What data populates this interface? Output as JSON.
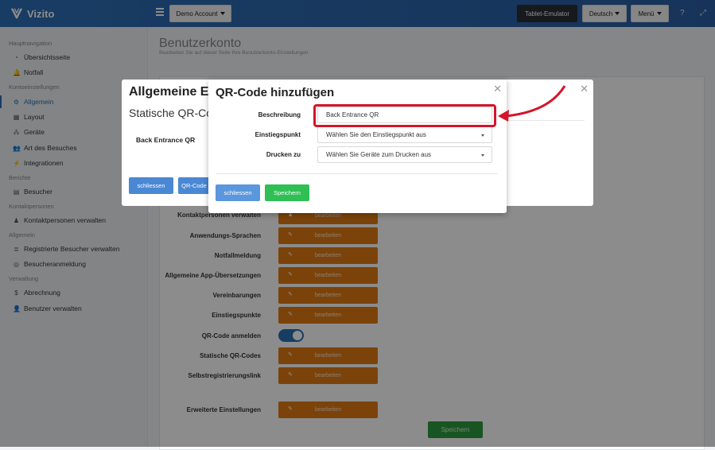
{
  "brand": "Vizito",
  "topbar": {
    "account": "Demo Account",
    "tablet": "Tablet-Emulator",
    "language": "Deutsch",
    "menu": "Menü"
  },
  "sidebar": {
    "sections": [
      {
        "title": "Hauptnavigation",
        "items": [
          {
            "label": "Übersichtsseite",
            "icon": "dashboard-icon"
          },
          {
            "label": "Notfall",
            "icon": "bell-icon"
          }
        ]
      },
      {
        "title": "Kontoeinstellungen",
        "items": [
          {
            "label": "Allgemein",
            "icon": "gear-icon"
          },
          {
            "label": "Layout",
            "icon": "layout-icon"
          },
          {
            "label": "Geräte",
            "icon": "devices-icon"
          },
          {
            "label": "Art des Besuches",
            "icon": "users-icon"
          },
          {
            "label": "Integrationen",
            "icon": "plug-icon"
          }
        ]
      },
      {
        "title": "Berichte",
        "items": [
          {
            "label": "Besucher",
            "icon": "report-icon"
          }
        ]
      },
      {
        "title": "Kontaktpersonen",
        "items": [
          {
            "label": "Kontaktpersonen verwalten",
            "icon": "person-icon"
          }
        ]
      },
      {
        "title": "Allgemein",
        "items": [
          {
            "label": "Registrierte Besucher verwalten",
            "icon": "list-icon"
          },
          {
            "label": "Besucheranmeldung",
            "icon": "target-icon"
          }
        ]
      },
      {
        "title": "Verwaltung",
        "items": [
          {
            "label": "Abrechnung",
            "icon": "dollar-icon"
          },
          {
            "label": "Benutzer verwalten",
            "icon": "user-plus-icon"
          }
        ]
      }
    ]
  },
  "page": {
    "title": "Benutzerkonto",
    "subtitle": "Bearbeiten Sie auf dieser Seite Ihre Benutzerkonto-Einstellungen"
  },
  "settings_rows": [
    {
      "label": "Kontaktpersonen verwalten",
      "button": "bearbeiten"
    },
    {
      "label": "Anwendungs-Sprachen",
      "button": "bearbeiten"
    },
    {
      "label": "Notfallmeldung",
      "button": "bearbeiten"
    },
    {
      "label": "Allgemeine App-Übersetzungen",
      "button": "bearbeiten"
    },
    {
      "label": "Vereinbarungen",
      "button": "bearbeiten"
    },
    {
      "label": "Einstiegspunkte",
      "button": "bearbeiten"
    },
    {
      "label": "QR-Code anmelden",
      "toggle": true
    },
    {
      "label": "Statische QR-Codes",
      "button": "bearbeiten"
    },
    {
      "label": "Selbstregistrierungslink",
      "button": "bearbeiten"
    },
    {
      "label": "Erweiterte Einstellungen",
      "button": "bearbeiten"
    }
  ],
  "main_save": "Speichern",
  "back_modal": {
    "title": "Allgemeine Eins",
    "subtitle": "Statische QR-Code",
    "qr_label": "Back Entrance QR",
    "close_btn": "schliessen",
    "qr_btn": "QR-Code"
  },
  "modal": {
    "title": "QR-Code hinzufügen",
    "fields": {
      "description_label": "Beschreibung",
      "description_value": "Back Entrance QR",
      "entry_label": "Einstiegspunkt",
      "entry_value": "Wählen Sie den Einstiegspunkt aus",
      "print_label": "Drucken zu",
      "print_value": "Wählen Sie Geräte zum Drucken aus"
    },
    "close_btn": "schliessen",
    "save_btn": "Speichern"
  },
  "annotation_color": "#d4152a"
}
